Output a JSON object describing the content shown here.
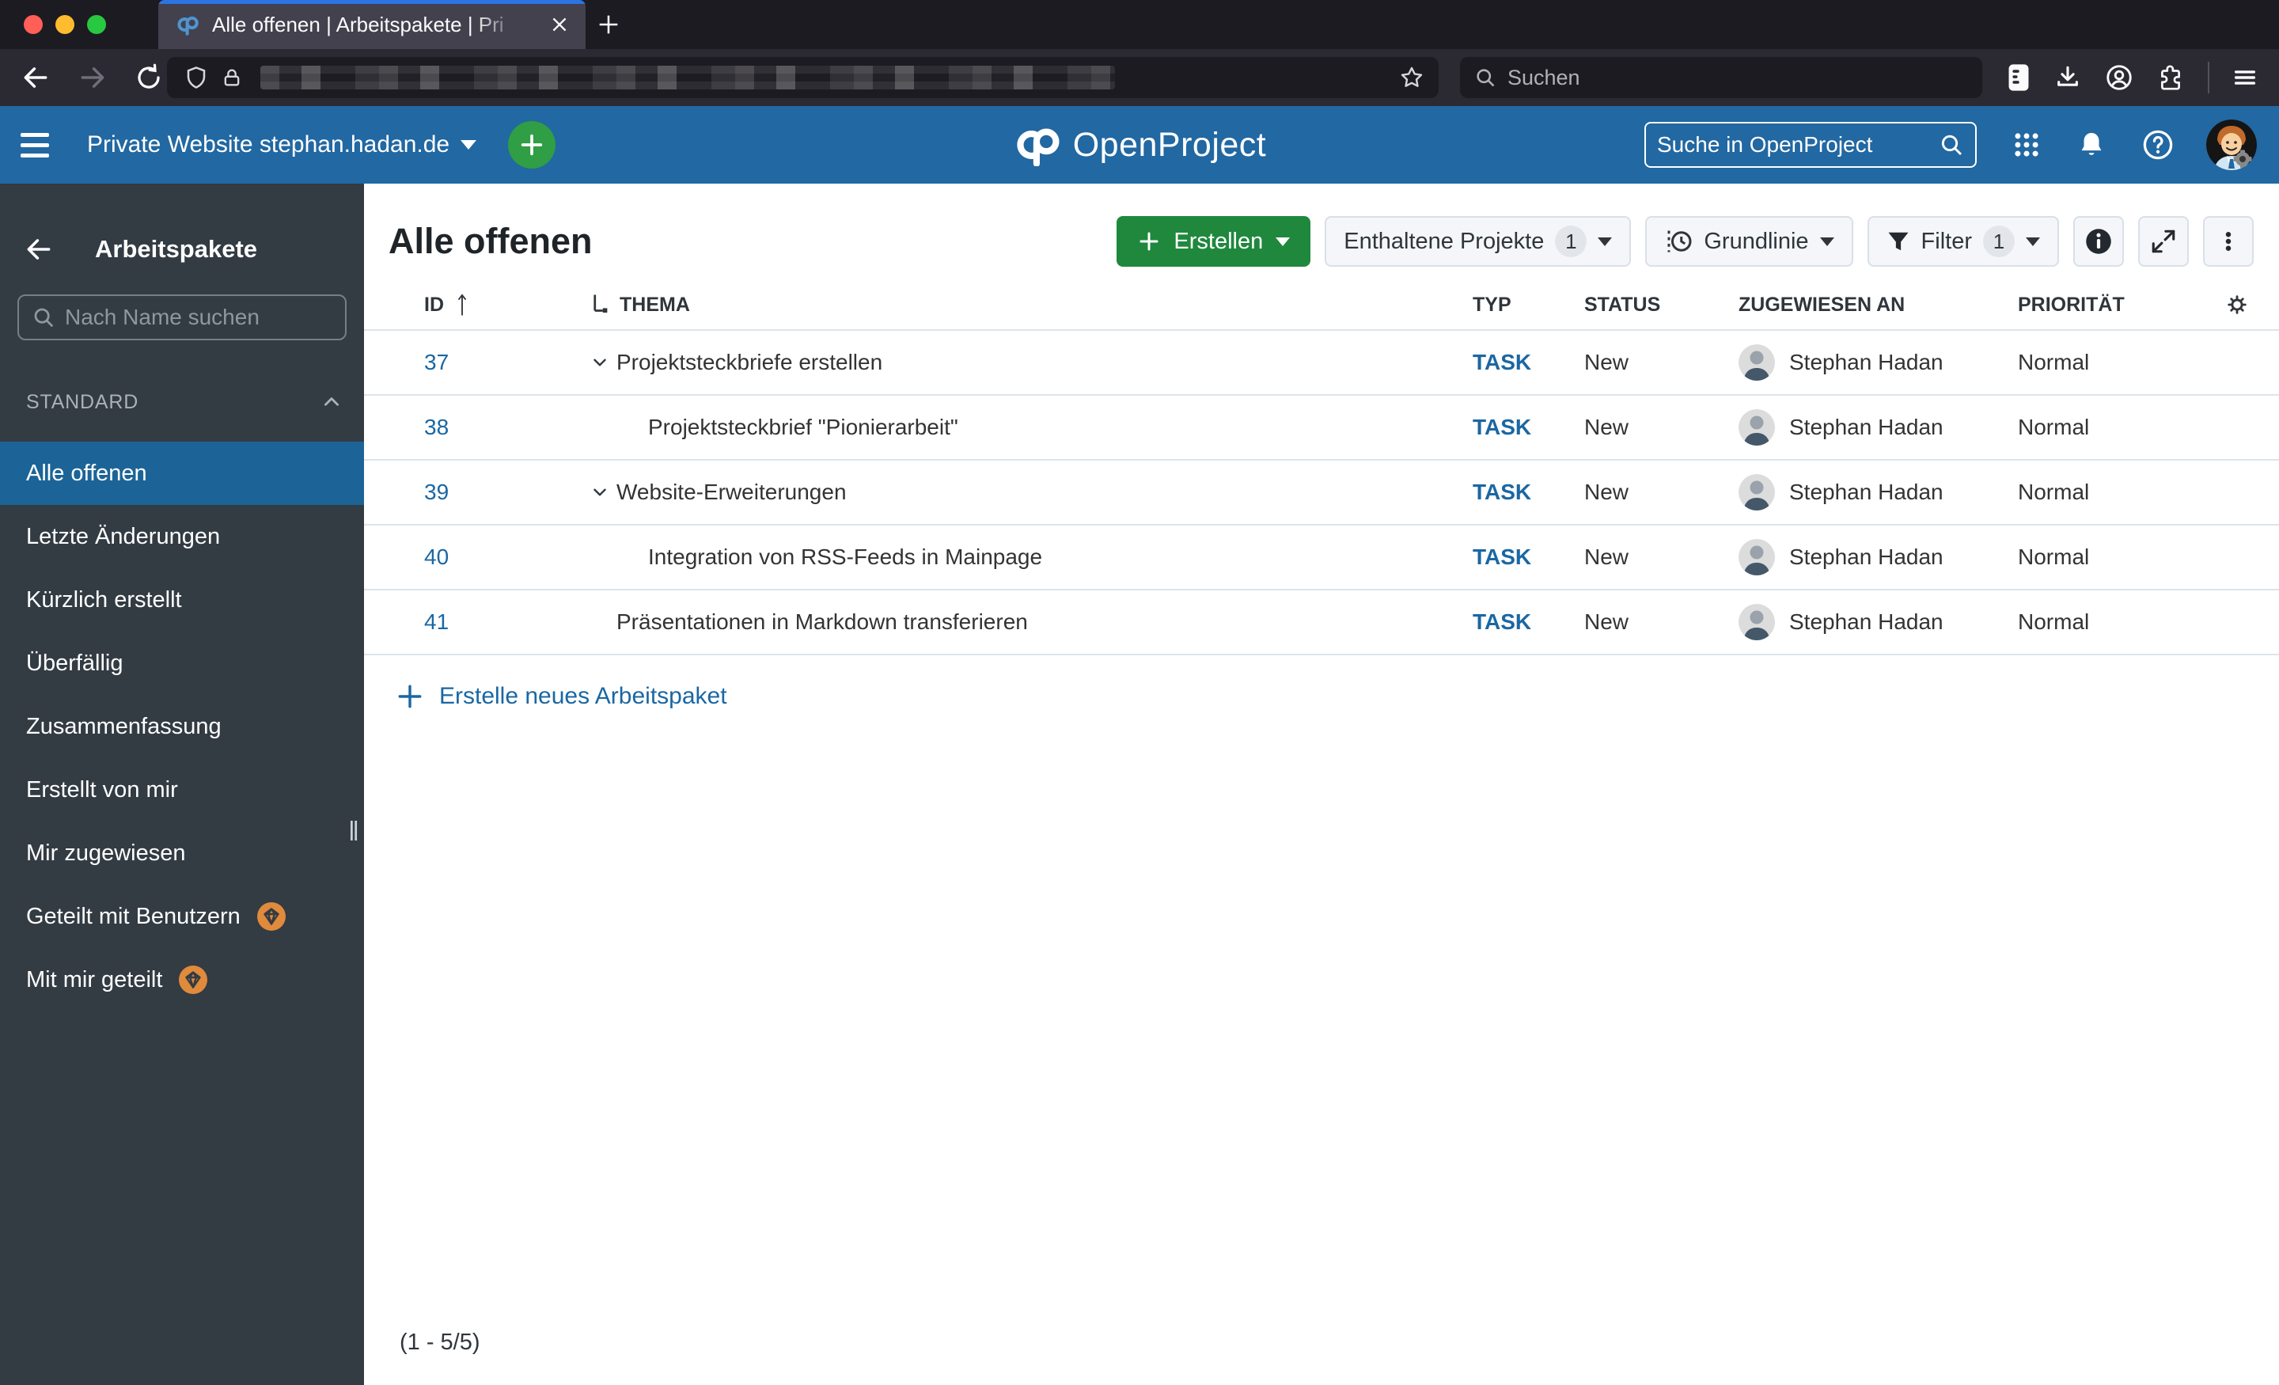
{
  "browser": {
    "tab_title": "Alle offenen | Arbeitspakete | Pri",
    "search_placeholder": "Suchen"
  },
  "op_header": {
    "project_name": "Private Website stephan.hadan.de",
    "logo_text": "OpenProject",
    "search_placeholder": "Suche in OpenProject"
  },
  "sidebar": {
    "title": "Arbeitspakete",
    "search_placeholder": "Nach Name suchen",
    "section_label": "STANDARD",
    "items": [
      {
        "label": "Alle offenen"
      },
      {
        "label": "Letzte Änderungen"
      },
      {
        "label": "Kürzlich erstellt"
      },
      {
        "label": "Überfällig"
      },
      {
        "label": "Zusammenfassung"
      },
      {
        "label": "Erstellt von mir"
      },
      {
        "label": "Mir zugewiesen"
      },
      {
        "label": "Geteilt mit Benutzern",
        "badge": "enterprise-gem"
      },
      {
        "label": "Mit mir geteilt",
        "badge": "enterprise-gem"
      }
    ]
  },
  "toolbar": {
    "page_title": "Alle offenen",
    "create_label": "Erstellen",
    "projects_label": "Enthaltene Projekte",
    "projects_count": "1",
    "baseline_label": "Grundlinie",
    "filter_label": "Filter",
    "filter_count": "1"
  },
  "table": {
    "headers": {
      "id": "ID",
      "thema": "THEMA",
      "typ": "TYP",
      "status": "STATUS",
      "zugewiesen": "ZUGEWIESEN AN",
      "prioritaet": "PRIORITÄT"
    },
    "rows": [
      {
        "id": "37",
        "thema": "Projektsteckbriefe erstellen",
        "typ": "TASK",
        "status": "New",
        "zugewiesen": "Stephan Hadan",
        "prioritaet": "Normal",
        "has_children": true,
        "child": false
      },
      {
        "id": "38",
        "thema": "Projektsteckbrief \"Pionierarbeit\"",
        "typ": "TASK",
        "status": "New",
        "zugewiesen": "Stephan Hadan",
        "prioritaet": "Normal",
        "has_children": false,
        "child": true
      },
      {
        "id": "39",
        "thema": "Website-Erweiterungen",
        "typ": "TASK",
        "status": "New",
        "zugewiesen": "Stephan Hadan",
        "prioritaet": "Normal",
        "has_children": true,
        "child": false
      },
      {
        "id": "40",
        "thema": "Integration von RSS-Feeds in Mainpage",
        "typ": "TASK",
        "status": "New",
        "zugewiesen": "Stephan Hadan",
        "prioritaet": "Normal",
        "has_children": false,
        "child": true
      },
      {
        "id": "41",
        "thema": "Präsentationen in Markdown transferieren",
        "typ": "TASK",
        "status": "New",
        "zugewiesen": "Stephan Hadan",
        "prioritaet": "Normal",
        "has_children": false,
        "child": false
      }
    ],
    "create_link_label": "Erstelle neues Arbeitspaket",
    "pagination": "(1 - 5/5)"
  },
  "colors": {
    "header-blue": "#2268a2",
    "sidebar-bg": "#333b43",
    "sidebar-sel": "#1c6497",
    "green": "#1f883d",
    "green-circle": "#2f9e44",
    "link": "#1a67a3",
    "orange": "#e08a3c",
    "row-border": "#dce4eb",
    "text": "#30353a"
  }
}
